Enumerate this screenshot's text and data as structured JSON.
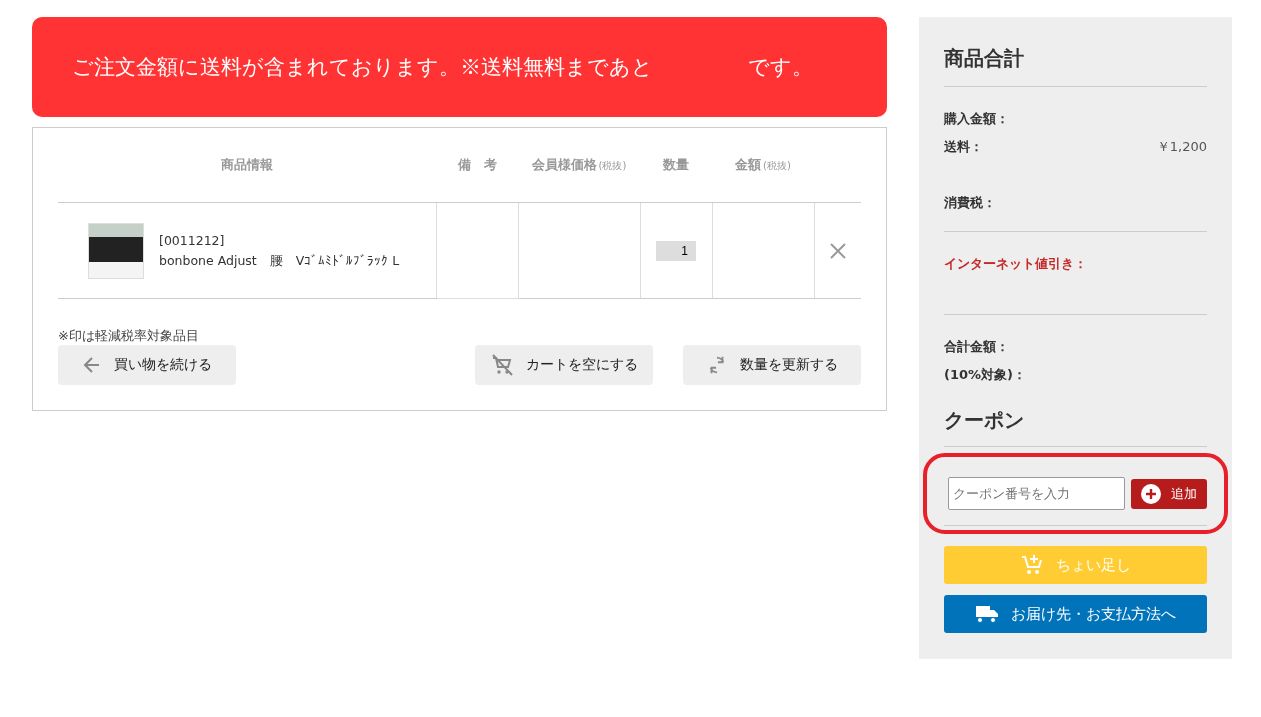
{
  "notice": {
    "text": "ご注文金額に送料が含まれております。※送料無料まであと",
    "suffix": "です。"
  },
  "table": {
    "columns": [
      {
        "label": "商品情報"
      },
      {
        "label": "備　考"
      },
      {
        "label": "会員様価格",
        "note": "(税抜)"
      },
      {
        "label": "数量"
      },
      {
        "label": "金額",
        "note": "(税抜)"
      }
    ],
    "rows": [
      {
        "code": "[0011212]",
        "name": "bonbone Adjust　腰　Vｺﾞﾑﾐﾄﾞﾙﾌﾞﾗｯｸ L",
        "quantity": "1"
      }
    ]
  },
  "footnote": "※印は軽減税率対象品目",
  "actions": [
    {
      "kind": "back",
      "label": "買い物を続ける"
    },
    {
      "kind": "empty",
      "label": "カートを空にする"
    },
    {
      "kind": "update",
      "label": "数量を更新する"
    }
  ],
  "summary": {
    "title": "商品合計",
    "groups": [
      [
        {
          "kind": "plain",
          "label": "購入金額："
        },
        {
          "kind": "plain",
          "label": "送料：",
          "value": "￥1,200"
        },
        {
          "kind": "plain",
          "label": "消費税：",
          "spaced": true
        }
      ],
      [
        {
          "kind": "discount",
          "label": "インターネット値引き："
        }
      ],
      [
        {
          "kind": "plain",
          "label": "合計金額："
        },
        {
          "kind": "plain",
          "label": "(10%対象)："
        }
      ]
    ],
    "coupon_title": "クーポン",
    "coupon": {
      "placeholder": "クーポン番号を入力",
      "button": "追加",
      "highlighted": true
    },
    "buttons": [
      {
        "kind": "add",
        "label": "ちょい足し"
      },
      {
        "kind": "checkout",
        "label": "お届け先・お支払方法へ"
      }
    ]
  }
}
